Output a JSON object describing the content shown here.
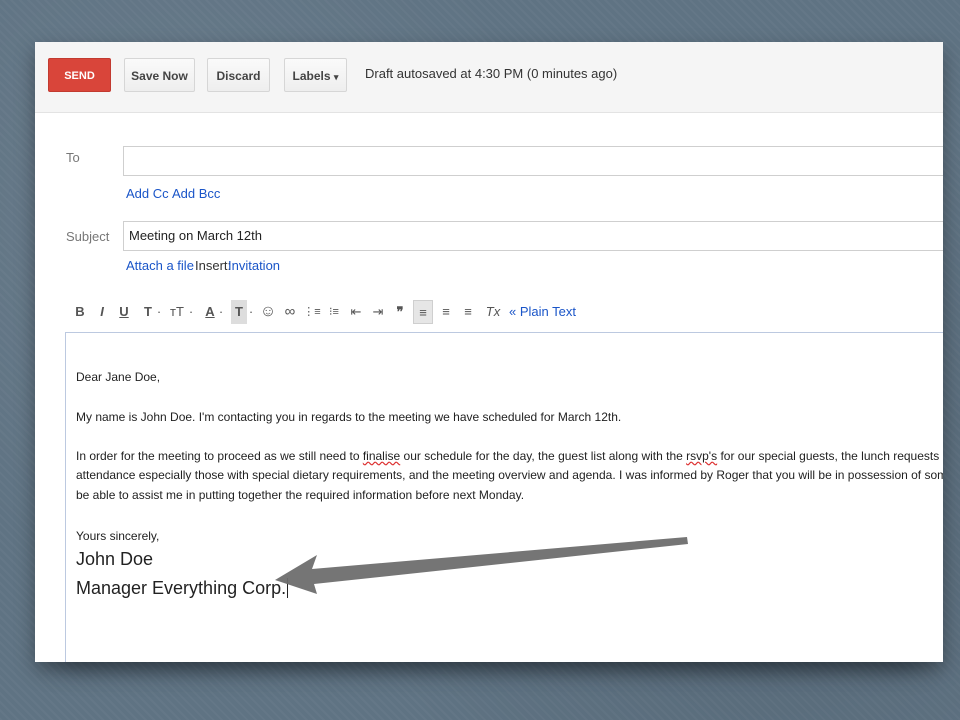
{
  "toolbar": {
    "send_label": "SEND",
    "save_label": "Save Now",
    "discard_label": "Discard",
    "labels_label": "Labels",
    "labels_caret": "▾",
    "autosave_text": "Draft autosaved at 4:30 PM (0 minutes ago)"
  },
  "compose": {
    "to_label": "To",
    "to_value": "",
    "add_cc": "Add Cc",
    "add_bcc": "Add Bcc",
    "subject_label": "Subject",
    "subject_value": "Meeting on March 12th",
    "attach_label": "Attach a file",
    "insert_label": "Insert:",
    "invitation_label": "Invitation"
  },
  "format_bar": {
    "bold": "B",
    "italic": "I",
    "underline": "U",
    "font": "T",
    "size": "тT",
    "text_color": "A",
    "highlight": "T",
    "dropdown": "·",
    "emoji": "☺",
    "link": "∞",
    "numbered_list": "⋮≡",
    "bulleted_list": "⁝≡",
    "indent_less": "⇤",
    "indent_more": "⇥",
    "quote": "❞",
    "align_left": "≡",
    "align_center": "≡",
    "align_right": "≡",
    "remove_format": "Tx",
    "plain_text": "« Plain Text"
  },
  "body": {
    "greeting": "Dear Jane Doe,",
    "para1": "My name is John Doe. I'm contacting you in regards to the meeting we have scheduled for March 12th.",
    "para2_a": "In order for the meeting to proceed as we still need to ",
    "para2_spell1": "finalise",
    "para2_b": " our schedule for the day, the guest list along with the ",
    "para2_spell2": "rsvp's",
    "para2_c": " for our special guests, the lunch requests of everyone",
    "para2_line2": "attendance especially those with special dietary requirements, and the meeting overview and agenda. I was informed by Roger that you will be in possession of some of these",
    "para2_line3": "be able to assist me in putting together the required information before next Monday.",
    "closing": "Yours sincerely,",
    "sig_name": "John Doe",
    "sig_title": "Manager Everything Corp."
  },
  "colors": {
    "send_button": "#d9453a",
    "link": "#1a55c8",
    "arrow": "#6e6e6e"
  }
}
